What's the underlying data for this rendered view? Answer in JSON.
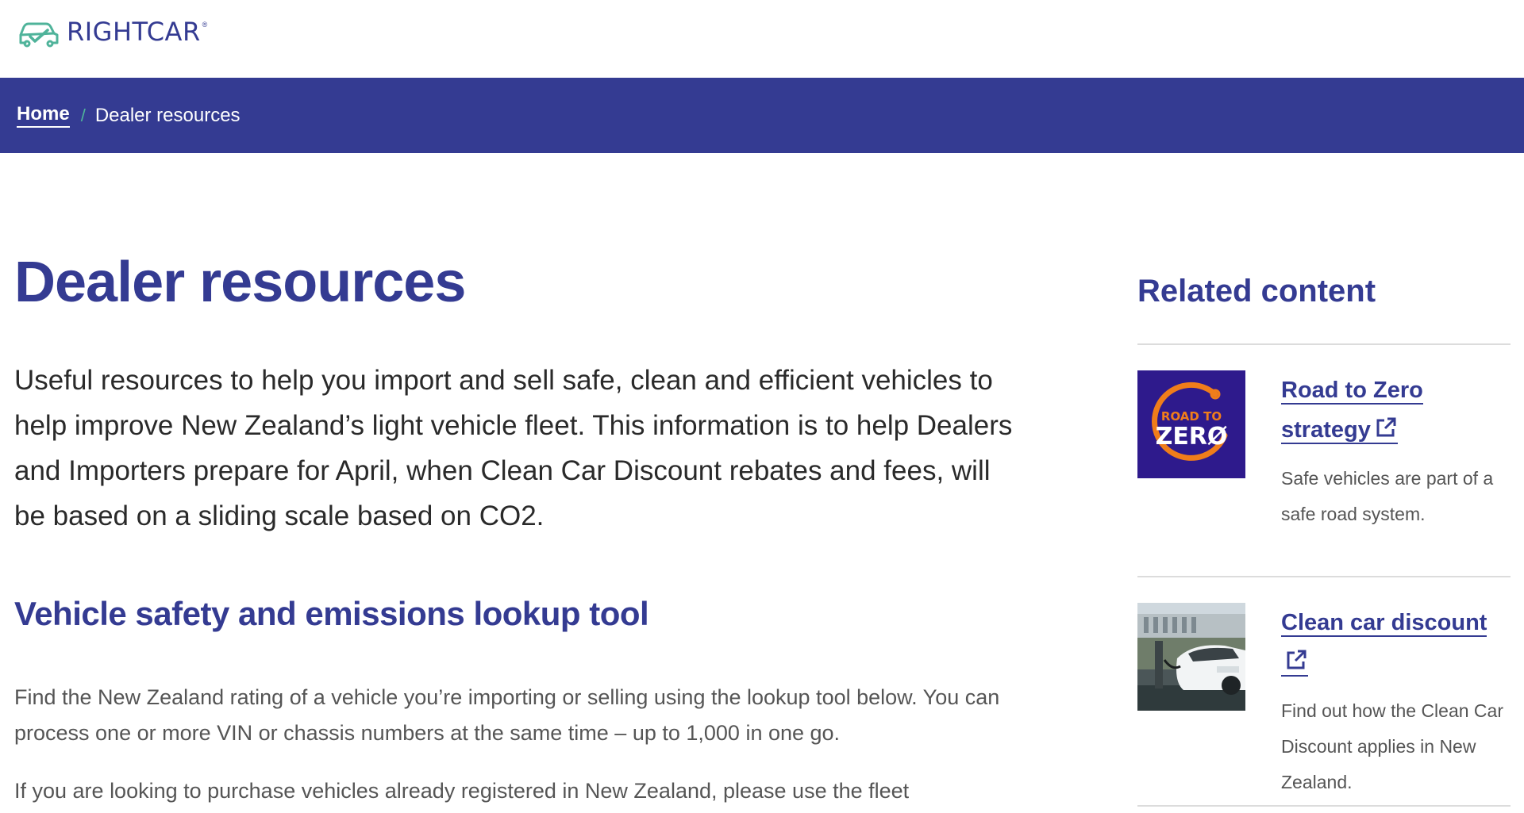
{
  "header": {
    "logo_text": "RIGHTCAR",
    "logo_reg": "®"
  },
  "breadcrumb": {
    "home": "Home",
    "separator": "/",
    "current": "Dealer resources"
  },
  "main": {
    "title": "Dealer resources",
    "intro": "Useful resources to help you import and sell safe, clean and efficient vehicles to help improve New Zealand’s light vehicle fleet. This information is to help Dealers and Importers prepare for April, when Clean Car Discount rebates and fees, will be based on a sliding scale based on CO2.",
    "section_heading": "Vehicle safety and emissions lookup tool",
    "paragraph_1": "Find the New Zealand rating of a vehicle you’re importing or selling using the lookup tool below. You can process one or more VIN or chassis numbers at the same time – up to 1,000 in one go.",
    "paragraph_2": "If you are looking to purchase vehicles already registered in New Zealand, please use the fleet"
  },
  "sidebar": {
    "heading": "Related content",
    "cards": [
      {
        "title": "Road to Zero strategy",
        "description": "Safe vehicles are part of a safe road system.",
        "thumb_top": "ROAD TO",
        "thumb_bottom": "ZERØ",
        "icon": "external-link-icon"
      },
      {
        "title": "Clean car discount",
        "description": "Find out how the Clean Car Discount applies in New Zealand.",
        "icon": "external-link-icon"
      }
    ]
  },
  "colors": {
    "brand_navy": "#343b92",
    "accent_green": "#4fb39a",
    "road_to_zero_bg": "#2e1a8c",
    "road_to_zero_orange": "#f07d1a"
  }
}
